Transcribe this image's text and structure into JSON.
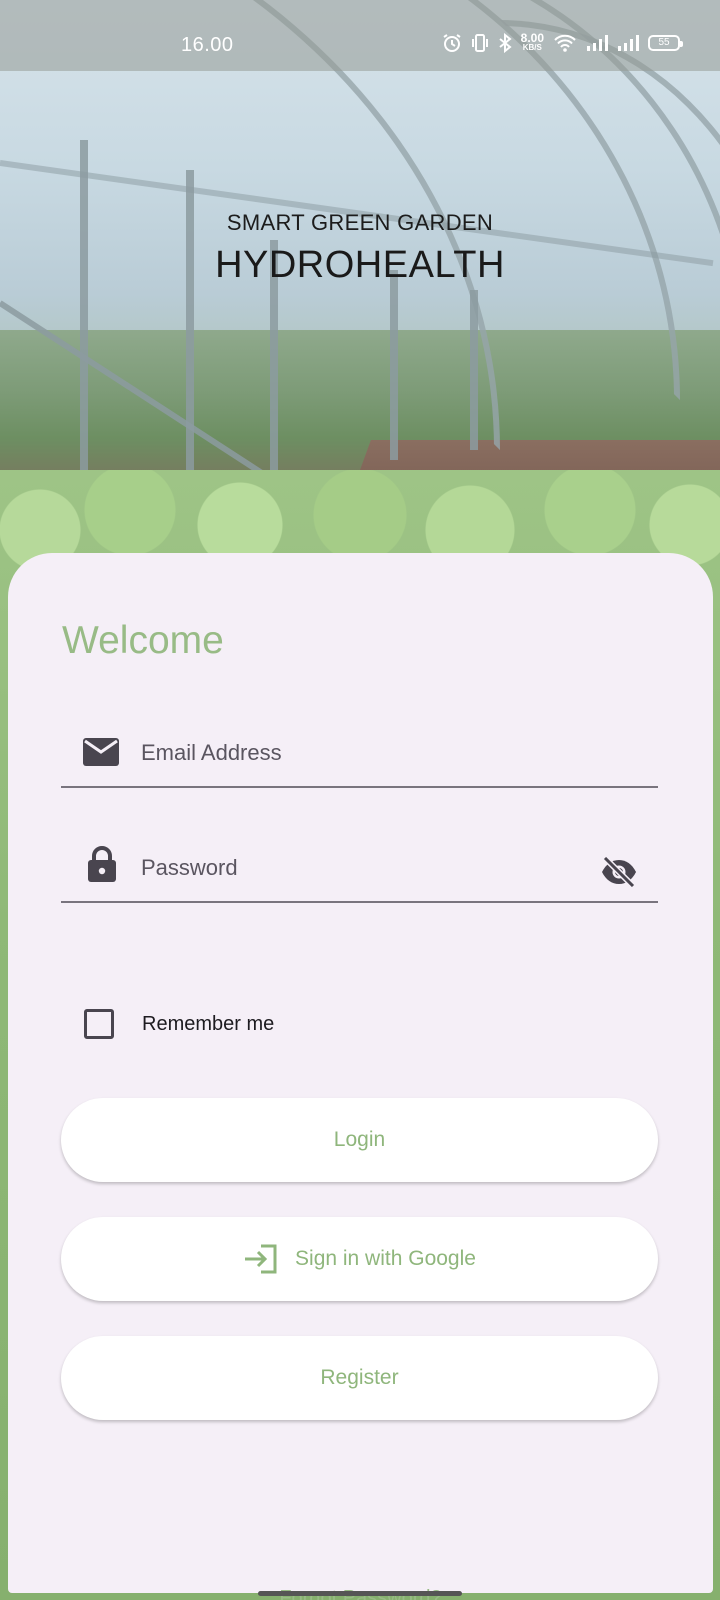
{
  "status_bar": {
    "time": "16.00",
    "net_speed_value": "8.00",
    "net_speed_unit": "KB/S",
    "battery": "55",
    "icons": [
      "alarm-icon",
      "vibrate-icon",
      "bluetooth-icon",
      "wifi-icon",
      "signal-icon",
      "signal-icon",
      "battery-icon"
    ]
  },
  "header": {
    "subtitle": "SMART GREEN GARDEN",
    "title": "HYDROHEALTH"
  },
  "login": {
    "welcome": "Welcome",
    "email": {
      "placeholder": "Email Address",
      "value": "",
      "icon": "email-icon"
    },
    "password": {
      "placeholder": "Password",
      "value": "",
      "icon": "lock-icon",
      "toggle_icon": "visibility-off-icon"
    },
    "remember_me": {
      "label": "Remember me",
      "checked": false
    },
    "buttons": {
      "login": "Login",
      "google": "Sign in with Google",
      "google_icon": "login-arrow-icon",
      "register": "Register"
    },
    "forgot_password": "Forgot Password?"
  },
  "colors": {
    "accent_green": "#98bb86",
    "card_background": "#f5eff7",
    "button_background": "#ffffff",
    "icon_dark": "#49454f"
  }
}
